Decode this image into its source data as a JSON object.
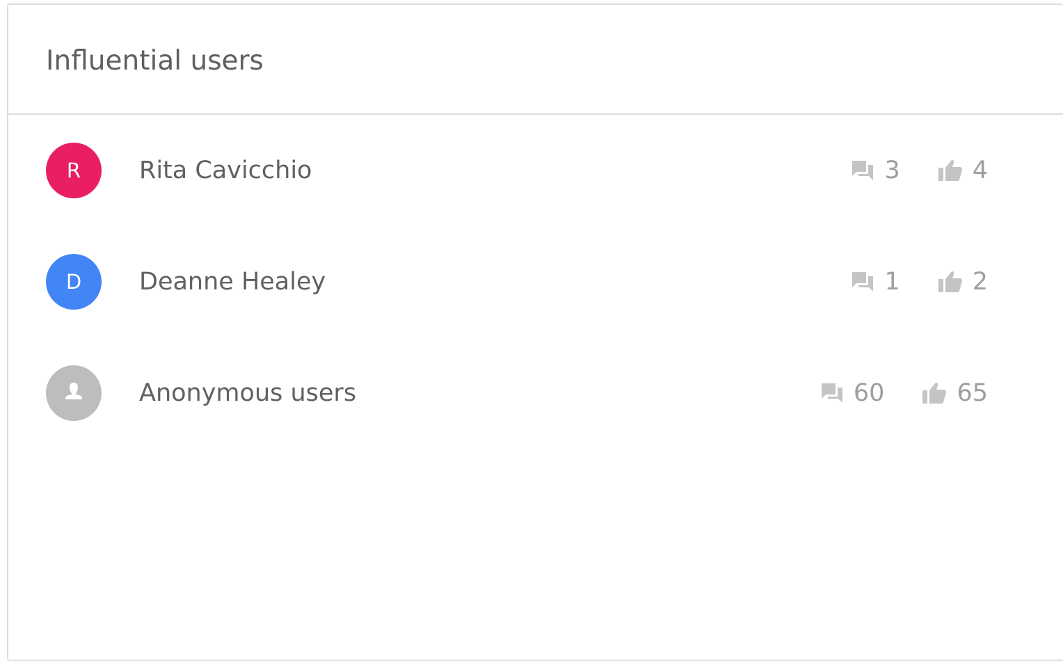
{
  "panel": {
    "title": "Influential users"
  },
  "users": [
    {
      "initial": "R",
      "name": "Rita Cavicchio",
      "avatar_color": "#e91e63",
      "comments": "3",
      "likes": "4",
      "anonymous": false
    },
    {
      "initial": "D",
      "name": "Deanne Healey",
      "avatar_color": "#4285f4",
      "comments": "1",
      "likes": "2",
      "anonymous": false
    },
    {
      "initial": "",
      "name": "Anonymous users",
      "avatar_color": "#bdbdbd",
      "comments": "60",
      "likes": "65",
      "anonymous": true,
      "avatar_icon": "person-icon"
    }
  ],
  "icons": {
    "comments": "comments-icon",
    "likes": "thumbs-up-icon"
  },
  "colors": {
    "icon_gray": "#c4c4c4",
    "count_gray": "#9e9e9e",
    "name_text": "#616161",
    "title_text": "#5f5f5f",
    "divider": "#dcdcdc"
  }
}
